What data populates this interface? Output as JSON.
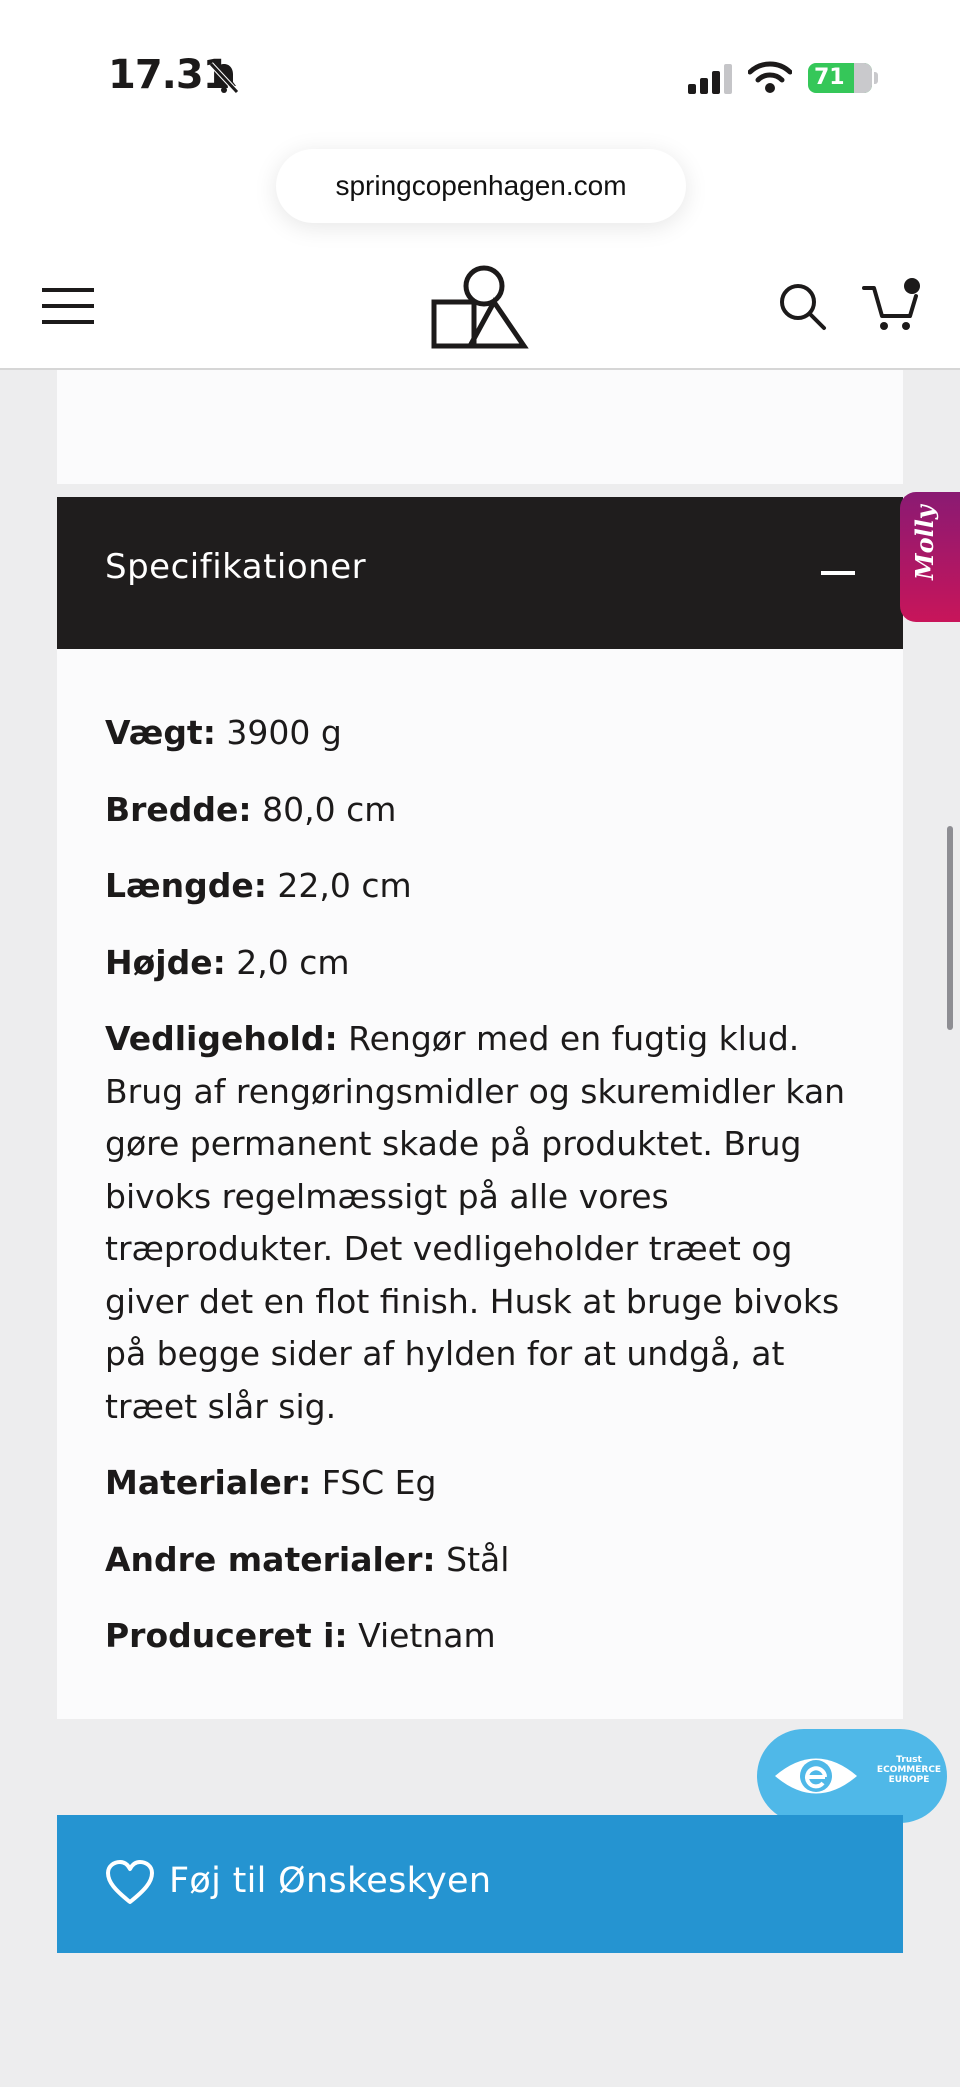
{
  "status_bar": {
    "time": "17.31",
    "battery": "71"
  },
  "browser": {
    "url": "springcopenhagen.com"
  },
  "header": {
    "menu_icon": "hamburger-menu-icon",
    "logo_icon": "spring-copenhagen-logo",
    "search_icon": "search-icon",
    "cart_icon": "cart-icon"
  },
  "accordion": {
    "title": "Specifikationer",
    "toggle_icon": "minus-icon"
  },
  "specs": [
    {
      "label": "Vægt:",
      "value": " 3900 g"
    },
    {
      "label": "Bredde:",
      "value": " 80,0 cm"
    },
    {
      "label": "Længde:",
      "value": " 22,0 cm"
    },
    {
      "label": "Højde:",
      "value": " 2,0 cm"
    },
    {
      "label": "Vedligehold:",
      "value": " Rengør med en fugtig klud. Brug af rengøringsmidler og skuremidler kan gøre permanent skade på produktet. Brug bivoks regelmæssigt på alle vores træprodukter. Det vedligeholder træet og giver det en flot finish. Husk at bruge bivoks på begge sider af hylden for at undgå, at træet slår sig."
    },
    {
      "label": "Materialer:",
      "value": " FSC Eg"
    },
    {
      "label": "Andre materialer:",
      "value": " Stål"
    },
    {
      "label": "Produceret i:",
      "value": " Vietnam"
    }
  ],
  "molly": {
    "label": "Molly"
  },
  "trust_badge": {
    "line1": "Trust",
    "line2": "ECOMMERCE",
    "line3": "EUROPE"
  },
  "wishlist": {
    "label": "Føj til Ønskeskyen",
    "icon": "heart-icon"
  },
  "colors": {
    "accordion_bg": "#1f1d1d",
    "wishlist_bg": "#2594d1",
    "molly_accent": "#c8155a"
  }
}
